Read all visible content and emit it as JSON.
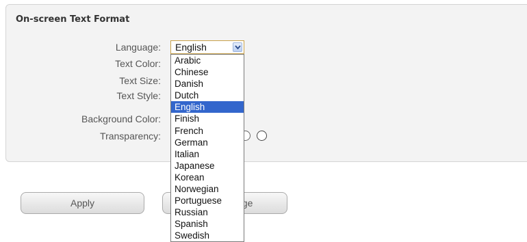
{
  "section": {
    "title": "On-screen Text Format"
  },
  "labels": {
    "language": "Language:",
    "text_color": "Text Color:",
    "text_size": "Text Size:",
    "text_style": "Text Style:",
    "background_color": "Background Color:",
    "transparency": "Transparency:"
  },
  "language_select": {
    "selected": "English",
    "options": [
      "Arabic",
      "Chinese",
      "Danish",
      "Dutch",
      "English",
      "Finish",
      "French",
      "German",
      "Italian",
      "Japanese",
      "Korean",
      "Norwegian",
      "Portuguese",
      "Russian",
      "Spanish",
      "Swedish"
    ]
  },
  "buttons": {
    "apply": "Apply",
    "partial_visible": "nge"
  },
  "colors": {
    "selection": "#3366cc",
    "select_border": "#c8a14a"
  }
}
